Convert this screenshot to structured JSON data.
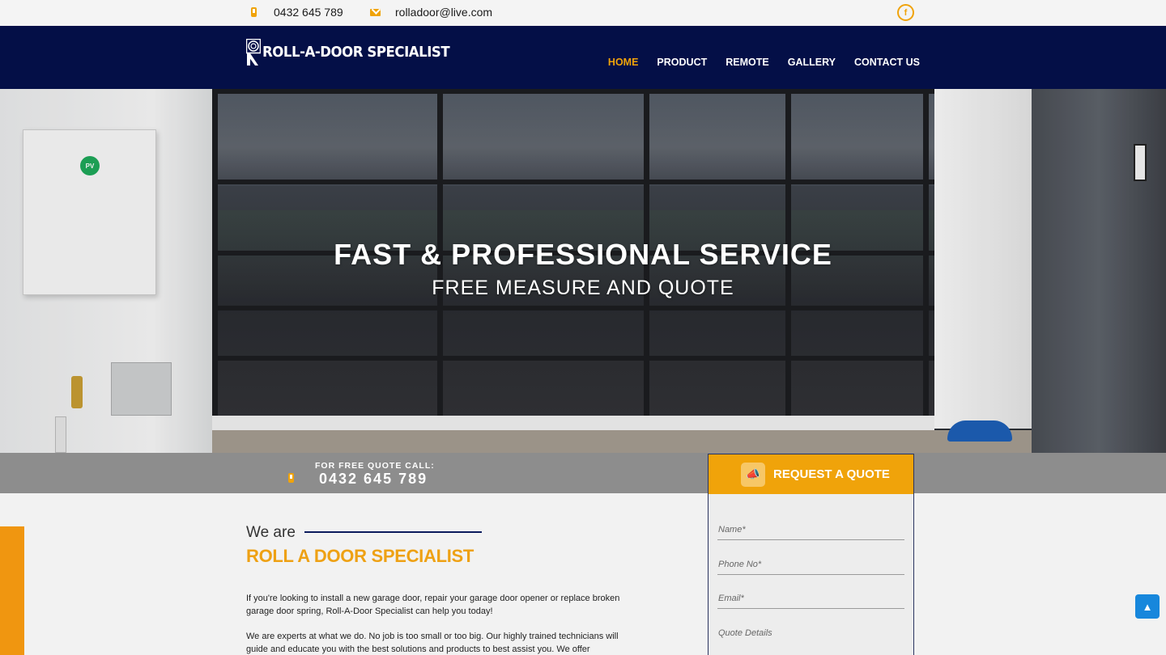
{
  "topbar": {
    "phone": "0432 645 789",
    "email": "rolladoor@live.com",
    "phone_icon": "mobile-phone-icon",
    "email_icon": "envelope-icon",
    "social_icon": "facebook-icon",
    "social_glyph": "f"
  },
  "nav": {
    "logo_text": "ROLL-A-DOOR SPECIALIST",
    "items": [
      {
        "label": "HOME",
        "active": true
      },
      {
        "label": "PRODUCT",
        "active": false
      },
      {
        "label": "REMOTE",
        "active": false
      },
      {
        "label": "GALLERY",
        "active": false
      },
      {
        "label": "CONTACT US",
        "active": false
      }
    ]
  },
  "hero": {
    "headline": "FAST & PROFESSIONAL SERVICE",
    "subheadline": "FREE MEASURE AND QUOTE",
    "meter_label": "PV"
  },
  "callstrip": {
    "label": "FOR FREE QUOTE CALL:",
    "number": "0432 645 789"
  },
  "quote_form": {
    "title": "REQUEST A QUOTE",
    "icon": "megaphone-icon",
    "icon_glyph": "📣",
    "name_placeholder": "Name*",
    "phone_placeholder": "Phone No*",
    "email_placeholder": "Email*",
    "details_placeholder": "Quote Details"
  },
  "about": {
    "intro": "We are",
    "title": "ROLL A DOOR SPECIALIST",
    "paragraph1": "If you're looking to install a new garage door, repair your garage door opener or replace broken garage door spring, Roll-A-Door Specialist can help you today!",
    "paragraph2": "We are experts at what we do. No job is too small or too big. Our highly trained technicians will guide and educate you with the best solutions and products to best assist you. We offer"
  },
  "scroll_top": {
    "icon": "chevron-up-icon",
    "glyph": "▲"
  },
  "colors": {
    "accent": "#f0a30a",
    "navy": "#040f47",
    "strip": "#8d8d8d",
    "title_orange": "#eea114"
  }
}
